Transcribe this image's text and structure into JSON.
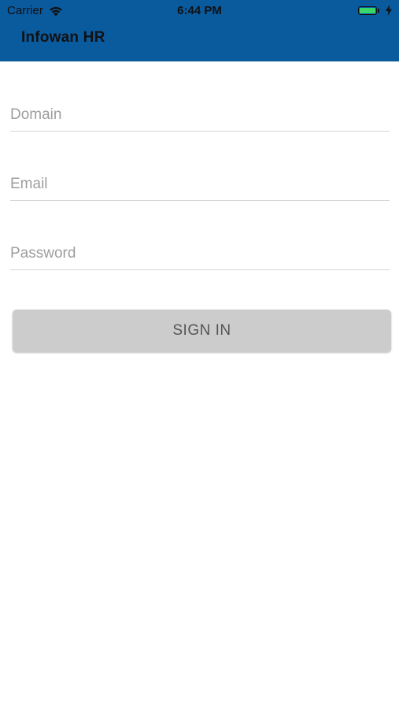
{
  "status_bar": {
    "carrier": "Carrier",
    "time": "6:44 PM",
    "battery_level": 1.0
  },
  "header": {
    "title": "Infowan HR",
    "color": "#0a5a9e"
  },
  "form": {
    "domain_placeholder": "Domain",
    "domain_value": "",
    "email_placeholder": "Email",
    "email_value": "",
    "password_placeholder": "Password",
    "password_value": ""
  },
  "sign_in": {
    "label": "SIGN IN",
    "color": "#cccccc"
  }
}
